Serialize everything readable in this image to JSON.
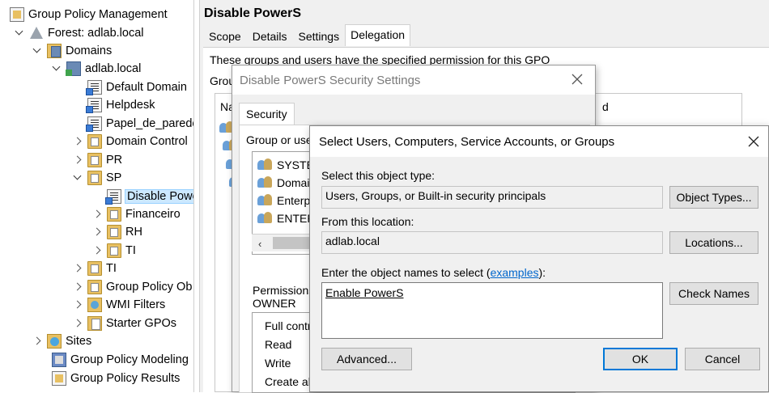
{
  "tree": {
    "root": "Group Policy Management",
    "forest": "Forest: adlab.local",
    "domains": "Domains",
    "domain": "adlab.local",
    "items": [
      "Default Domain",
      "Helpdesk",
      "Papel_de_parede",
      "Domain Control",
      "PR",
      "SP",
      "Disable Powe",
      "Financeiro",
      "RH",
      "TI",
      "TI",
      "Group Policy Ob",
      "WMI Filters",
      "Starter GPOs"
    ],
    "sites": "Sites",
    "modeling": "Group Policy Modeling",
    "results": "Group Policy Results"
  },
  "main": {
    "title": "Disable PowerS",
    "tabs": [
      "Scope",
      "Details",
      "Settings",
      "Delegation"
    ],
    "active_tab": "Delegation",
    "description": "These groups and users have the specified permission for this GPO",
    "groups_label": "Grou",
    "list_header_name": "Na",
    "list_header_right": "d"
  },
  "security": {
    "title": "Disable PowerS Security Settings",
    "tab": "Security",
    "group_label": "Group or use",
    "users": [
      "SYSTE",
      "Domai",
      "Enterp",
      "ENTER"
    ],
    "permissions_label_line1": "Permissions",
    "permissions_label_line2": "OWNER",
    "permissions": [
      "Full contro",
      "Read",
      "Write",
      "Create all child objects"
    ]
  },
  "select_dialog": {
    "title": "Select Users, Computers, Service Accounts, or Groups",
    "object_type_label": "Select this object type:",
    "object_type_value": "Users, Groups, or Built-in security principals",
    "object_types_button": "Object Types...",
    "location_label": "From this location:",
    "location_value": "adlab.local",
    "locations_button": "Locations...",
    "names_label_pre": "Enter the object names to select (",
    "names_label_link": "examples",
    "names_label_post": "):",
    "names_value": "Enable PowerS",
    "check_names_button": "Check Names",
    "advanced_button": "Advanced...",
    "ok_button": "OK",
    "cancel_button": "Cancel"
  }
}
